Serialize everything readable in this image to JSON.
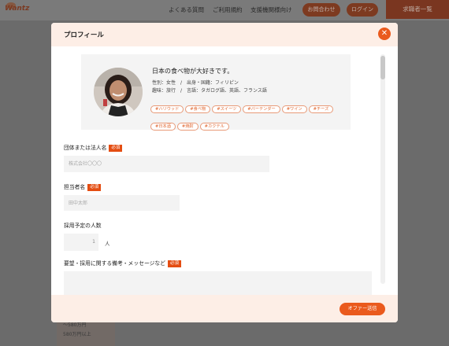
{
  "background": {
    "logo": "Wantz",
    "nav": [
      "よくある質問",
      "ご利用規約",
      "支援機関様向け"
    ],
    "contact_button": "お問合わせ",
    "login_button": "ログイン",
    "jobseekers_button": "求職者一覧",
    "salary_options": [
      "～580万円",
      "580万円以上"
    ]
  },
  "modal": {
    "title": "プロフィール",
    "close_icon": "close-icon",
    "profile": {
      "headline": "日本の食べ物が大好きです。",
      "line1": "性別：女性　/　出身・国籍：フィリピン",
      "line2": "趣味：旅行　/　言語：タガログ語、英語、フランス語",
      "tags": [
        "#ハリウッド",
        "#食べ物",
        "#スイーツ",
        "#バーテンダー",
        "#ワイン",
        "#チーズ",
        "#日本酒",
        "#焼酎",
        "#カクテル"
      ]
    },
    "form": {
      "org_label": "団体または法人名",
      "org_placeholder": "株式会社〇〇〇",
      "contact_label": "担当者名",
      "contact_placeholder": "田中太郎",
      "hires_label": "採用予定の人数",
      "hires_value": "1",
      "hires_unit": "人",
      "message_label": "要望・採用に関する備考・メッセージなど",
      "required_badge": "必須"
    },
    "submit_button": "オファー送信"
  },
  "colors": {
    "accent": "#ea5a1d",
    "header_bg": "#fdeee6",
    "tag_border": "#e89a78"
  }
}
